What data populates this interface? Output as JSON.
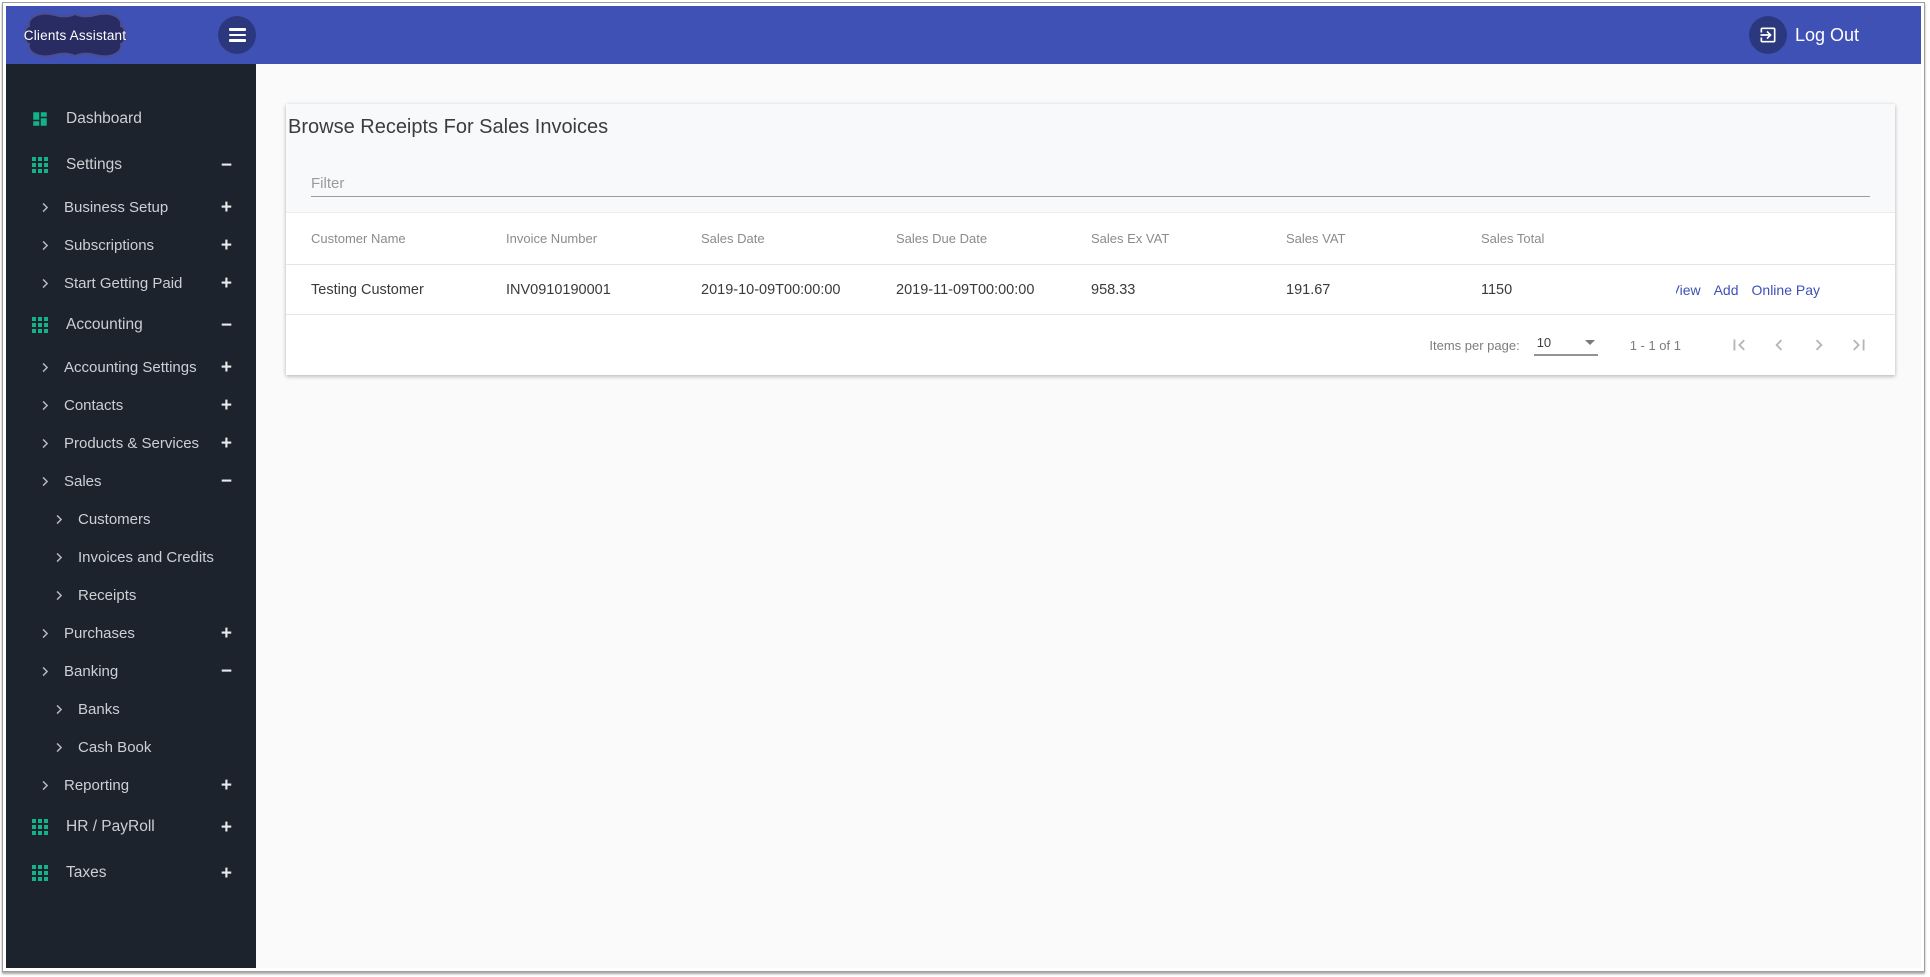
{
  "header": {
    "logo_text": "Clients Assistant",
    "logout_label": "Log Out"
  },
  "icons": {
    "menu": "hamburger",
    "logout": "exit-to-app",
    "top_level_nav": "green-grid",
    "dashboard_nav": "green-dashboard-tiles",
    "sub_nav": "chevron-right",
    "expand": "plus",
    "collapse": "minus",
    "paginator": [
      "first-page",
      "chevron-left",
      "chevron-right",
      "last-page"
    ],
    "page_size": "caret-down"
  },
  "sidebar": {
    "items": [
      {
        "label": "Dashboard",
        "level": "top",
        "icon": "dashboard",
        "expand": null
      },
      {
        "label": "Settings",
        "level": "top",
        "icon": "grid",
        "expand": "minus"
      },
      {
        "label": "Business Setup",
        "level": "sub",
        "expand": "plus"
      },
      {
        "label": "Subscriptions",
        "level": "sub",
        "expand": "plus"
      },
      {
        "label": "Start Getting Paid",
        "level": "sub",
        "expand": "plus"
      },
      {
        "label": "Accounting",
        "level": "top",
        "icon": "grid",
        "expand": "minus"
      },
      {
        "label": "Accounting Settings",
        "level": "sub",
        "expand": "plus"
      },
      {
        "label": "Contacts",
        "level": "sub",
        "expand": "plus"
      },
      {
        "label": "Products & Services",
        "level": "sub",
        "expand": "plus"
      },
      {
        "label": "Sales",
        "level": "sub",
        "expand": "minus"
      },
      {
        "label": "Customers",
        "level": "subsub",
        "expand": null
      },
      {
        "label": "Invoices and Credits",
        "level": "subsub",
        "expand": null
      },
      {
        "label": "Receipts",
        "level": "subsub",
        "expand": null
      },
      {
        "label": "Purchases",
        "level": "sub",
        "expand": "plus"
      },
      {
        "label": "Banking",
        "level": "sub",
        "expand": "minus"
      },
      {
        "label": "Banks",
        "level": "subsub",
        "expand": null
      },
      {
        "label": "Cash Book",
        "level": "subsub",
        "expand": null
      },
      {
        "label": "Reporting",
        "level": "sub",
        "expand": "plus"
      },
      {
        "label": "HR / PayRoll",
        "level": "top",
        "icon": "grid",
        "expand": "plus"
      },
      {
        "label": "Taxes",
        "level": "top",
        "icon": "grid",
        "expand": "plus"
      }
    ]
  },
  "main": {
    "title": "Browse Receipts For Sales Invoices",
    "filter_placeholder": "Filter",
    "table": {
      "columns": [
        "Customer Name",
        "Invoice Number",
        "Sales Date",
        "Sales Due Date",
        "Sales Ex VAT",
        "Sales VAT",
        "Sales Total"
      ],
      "rows": [
        {
          "customer_name": "Testing Customer",
          "invoice_number": "INV0910190001",
          "sales_date": "2019-10-09T00:00:00",
          "sales_due_date": "2019-11-09T00:00:00",
          "sales_ex_vat": "958.33",
          "sales_vat": "191.67",
          "sales_total": "1150",
          "actions": [
            "View",
            "Add",
            "Online Pay"
          ]
        }
      ]
    },
    "paginator": {
      "items_per_page_label": "Items per page:",
      "items_per_page_value": "10",
      "range_label": "1 - 1 of 1"
    }
  },
  "colors": {
    "topbar": "#3f51b5",
    "topbar_circle": "#2c387f",
    "sidebar_bg": "#1d232d",
    "sidebar_text": "#ccd0d5",
    "accent_green": "#13b289",
    "link_blue": "#3f51b5",
    "page_bg": "#fafafa",
    "card_bg": "#ffffff",
    "card_top_bg": "#f8f9fb",
    "header_text_gray": "#8b8b8b",
    "cell_text": "#3a3a3a",
    "paginator_icon_gray": "#b5b5b5"
  }
}
